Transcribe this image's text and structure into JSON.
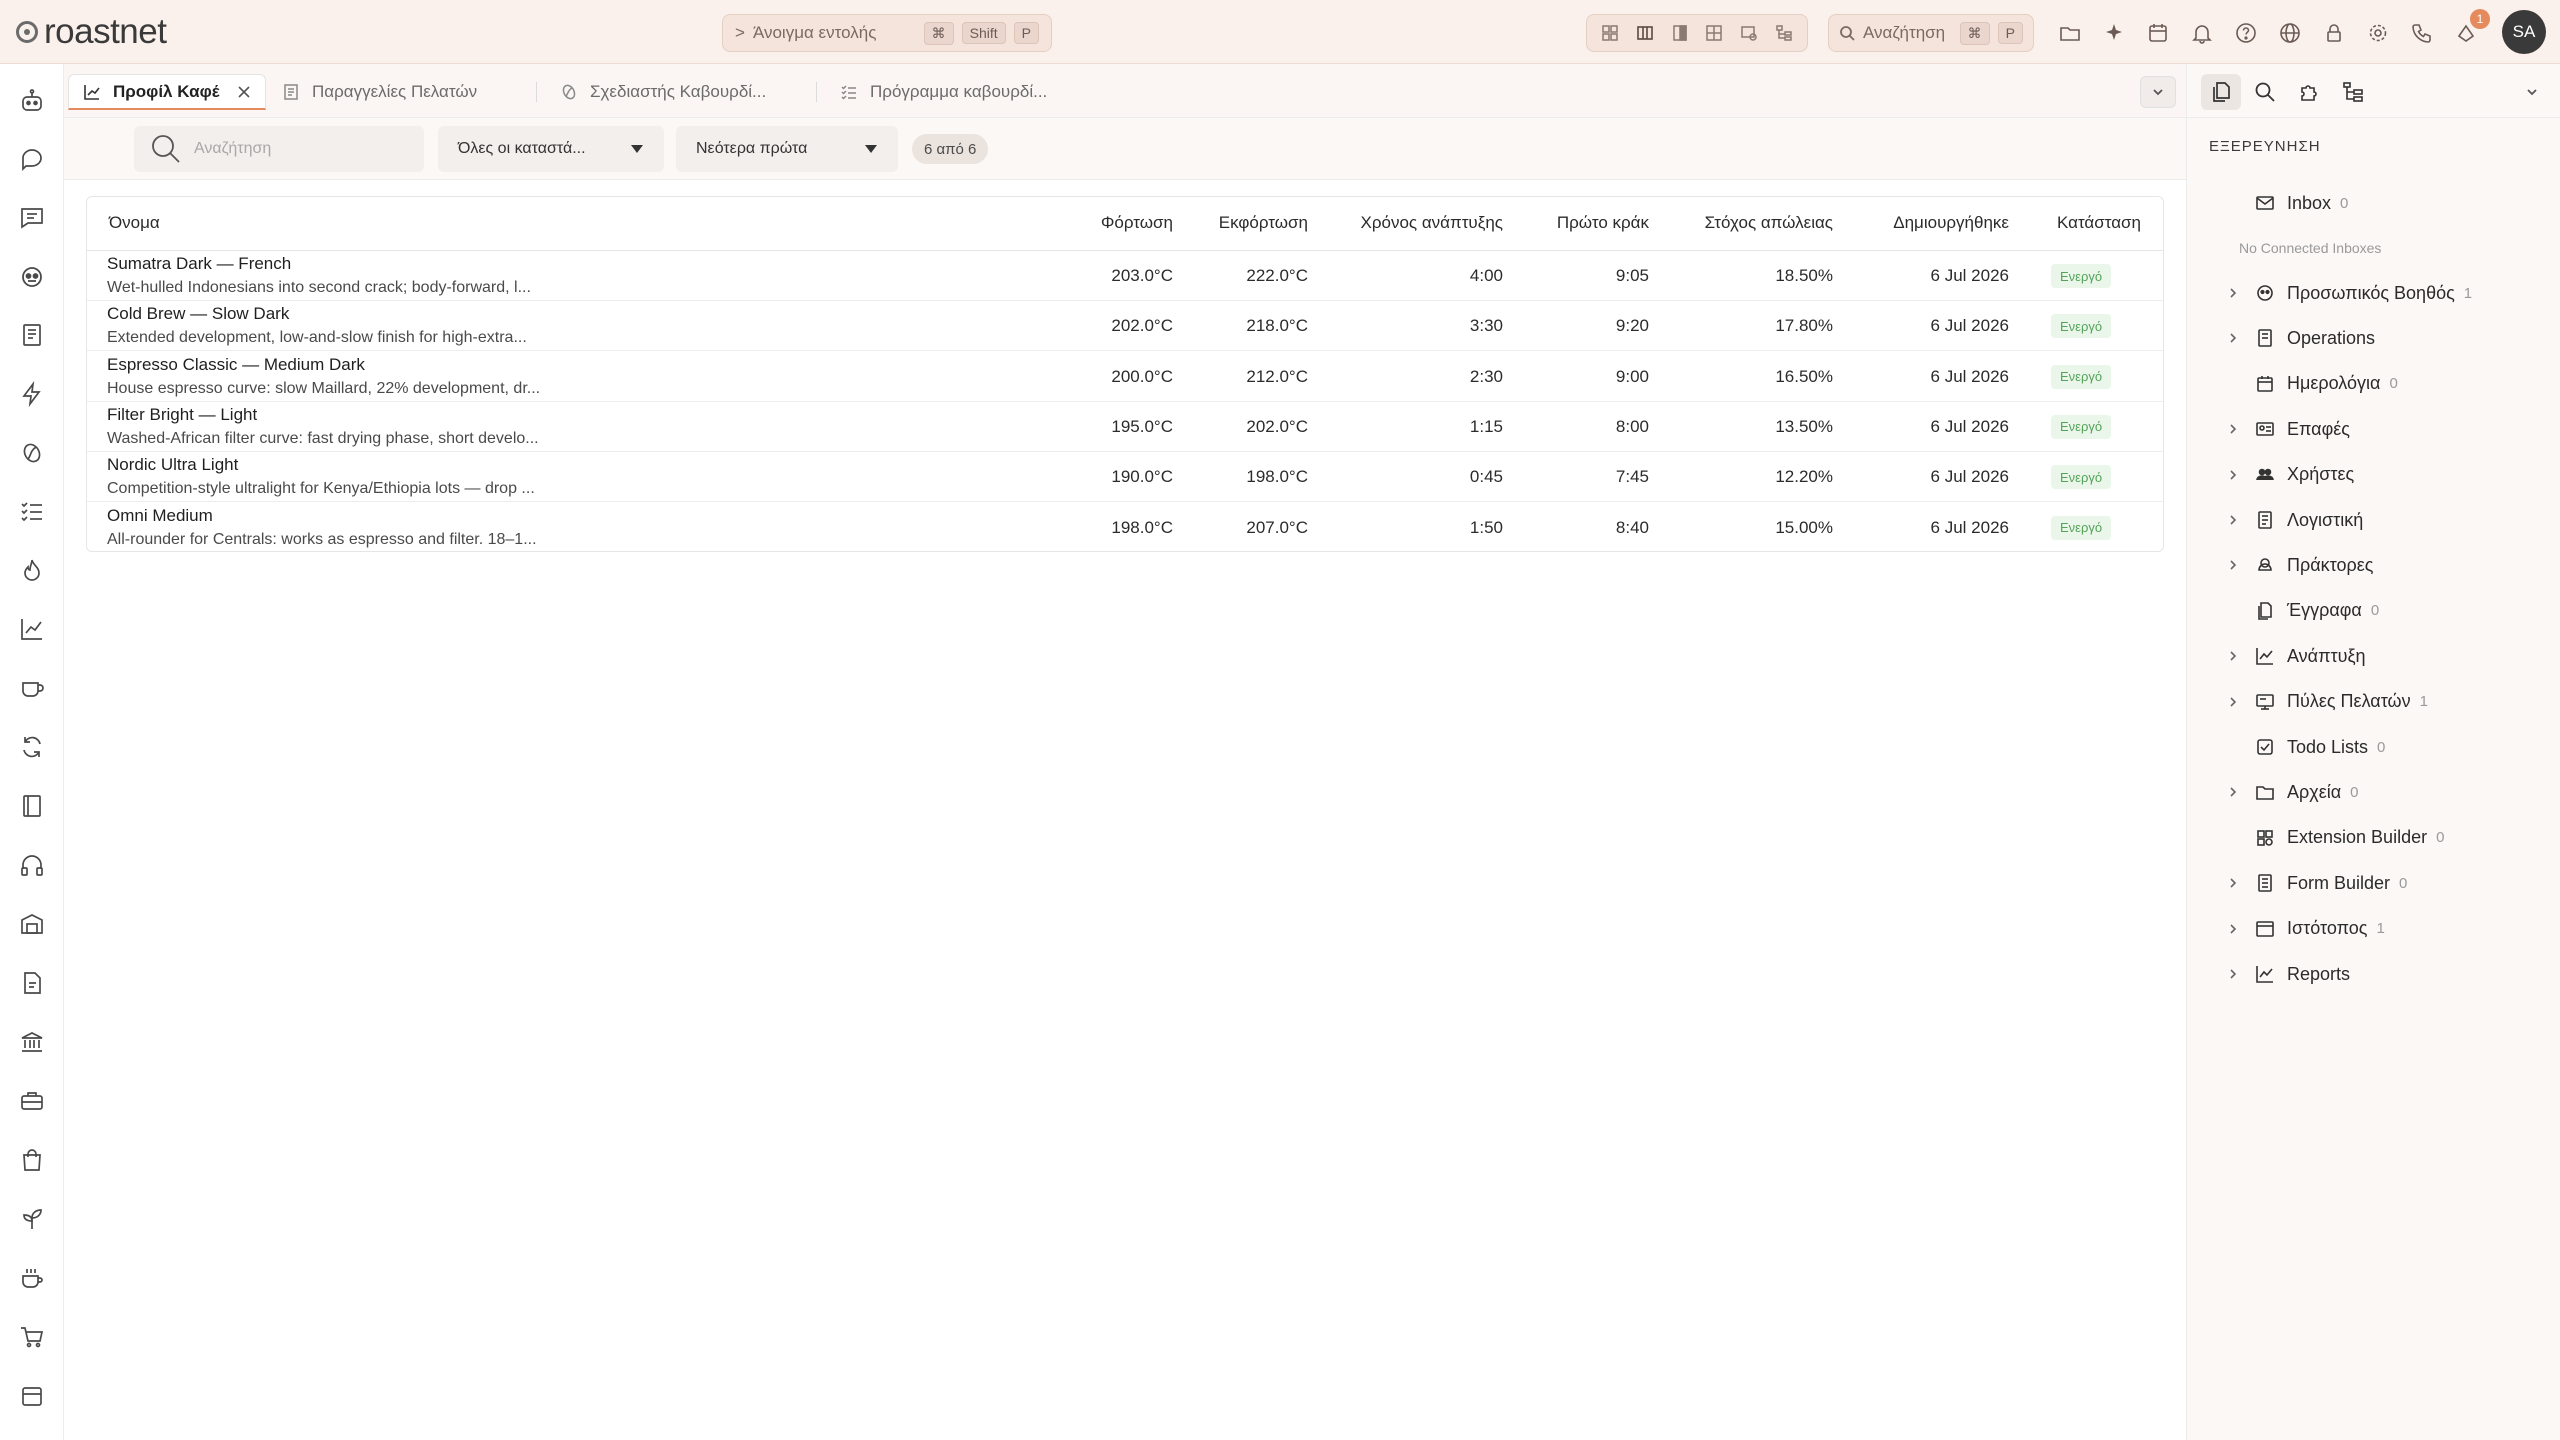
{
  "app": {
    "name": "roastnet"
  },
  "topbar": {
    "command": {
      "prefix": ">",
      "label": "Άνοιγμα εντολής",
      "keys": [
        "⌘",
        "Shift",
        "P"
      ]
    },
    "search": {
      "label": "Αναζήτηση",
      "keys": [
        "⌘",
        "P"
      ]
    },
    "notifications_badge": "1",
    "avatar_initials": "SA"
  },
  "tabs": [
    {
      "label": "Προφίλ Καφέ",
      "icon": "chart-line-icon",
      "active": true
    },
    {
      "label": "Παραγγελίες Πελατών",
      "icon": "document-icon",
      "active": false
    },
    {
      "label": "Σχεδιαστής Καβουρδί...",
      "icon": "bean-icon",
      "active": false
    },
    {
      "label": "Πρόγραμμα καβουρδί...",
      "icon": "list-check-icon",
      "active": false
    }
  ],
  "filters": {
    "search_placeholder": "Αναζήτηση",
    "status_select": "Όλες οι καταστά...",
    "sort_select": "Νεότερα πρώτα",
    "count": "6 από 6"
  },
  "table": {
    "columns": {
      "name": "Όνομα",
      "charge": "Φόρτωση",
      "drop": "Εκφόρτωση",
      "dev_time": "Χρόνος ανάπτυξης",
      "first_crack": "Πρώτο κράκ",
      "loss_target": "Στόχος απώλειας",
      "created": "Δημιουργήθηκε",
      "status": "Κατάσταση"
    },
    "rows": [
      {
        "name": "Sumatra Dark — French",
        "desc": "Wet-hulled Indonesians into second crack; body-forward, l...",
        "charge": "203.0°C",
        "drop": "222.0°C",
        "dev_time": "4:00",
        "first_crack": "9:05",
        "loss_target": "18.50%",
        "created": "6 Jul 2026",
        "status": "Ενεργό"
      },
      {
        "name": "Cold Brew — Slow Dark",
        "desc": "Extended development, low-and-slow finish for high-extra...",
        "charge": "202.0°C",
        "drop": "218.0°C",
        "dev_time": "3:30",
        "first_crack": "9:20",
        "loss_target": "17.80%",
        "created": "6 Jul 2026",
        "status": "Ενεργό"
      },
      {
        "name": "Espresso Classic — Medium Dark",
        "desc": "House espresso curve: slow Maillard, 22% development, dr...",
        "charge": "200.0°C",
        "drop": "212.0°C",
        "dev_time": "2:30",
        "first_crack": "9:00",
        "loss_target": "16.50%",
        "created": "6 Jul 2026",
        "status": "Ενεργό"
      },
      {
        "name": "Filter Bright — Light",
        "desc": "Washed-African filter curve: fast drying phase, short develo...",
        "charge": "195.0°C",
        "drop": "202.0°C",
        "dev_time": "1:15",
        "first_crack": "8:00",
        "loss_target": "13.50%",
        "created": "6 Jul 2026",
        "status": "Ενεργό"
      },
      {
        "name": "Nordic Ultra Light",
        "desc": "Competition-style ultralight for Kenya/Ethiopia lots — drop ...",
        "charge": "190.0°C",
        "drop": "198.0°C",
        "dev_time": "0:45",
        "first_crack": "7:45",
        "loss_target": "12.20%",
        "created": "6 Jul 2026",
        "status": "Ενεργό"
      },
      {
        "name": "Omni Medium",
        "desc": "All-rounder for Centrals: works as espresso and filter. 18–1...",
        "charge": "198.0°C",
        "drop": "207.0°C",
        "dev_time": "1:50",
        "first_crack": "8:40",
        "loss_target": "15.00%",
        "created": "6 Jul 2026",
        "status": "Ενεργό"
      }
    ]
  },
  "explorer": {
    "title": "ΕΞΕΡΕΥΝΗΣΗ",
    "inbox": {
      "label": "Inbox",
      "count": "0"
    },
    "no_inboxes": "No Connected Inboxes",
    "items": [
      {
        "label": "Προσωπικός Βοηθός",
        "count": "1",
        "icon": "robot-icon",
        "expandable": true
      },
      {
        "label": "Operations",
        "count": "",
        "icon": "server-icon",
        "expandable": true
      },
      {
        "label": "Ημερολόγια",
        "count": "0",
        "icon": "calendar-icon",
        "expandable": false
      },
      {
        "label": "Επαφές",
        "count": "",
        "icon": "contact-card-icon",
        "expandable": true
      },
      {
        "label": "Χρήστες",
        "count": "",
        "icon": "users-icon",
        "expandable": true
      },
      {
        "label": "Λογιστική",
        "count": "",
        "icon": "ledger-icon",
        "expandable": true
      },
      {
        "label": "Πράκτορες",
        "count": "",
        "icon": "agent-icon",
        "expandable": true
      },
      {
        "label": "Έγγραφα",
        "count": "0",
        "icon": "documents-icon",
        "expandable": false
      },
      {
        "label": "Ανάπτυξη",
        "count": "",
        "icon": "chart-line-icon",
        "expandable": true
      },
      {
        "label": "Πύλες Πελατών",
        "count": "1",
        "icon": "portal-icon",
        "expandable": true
      },
      {
        "label": "Todo Lists",
        "count": "0",
        "icon": "todo-icon",
        "expandable": false
      },
      {
        "label": "Αρχεία",
        "count": "0",
        "icon": "folder-icon",
        "expandable": true
      },
      {
        "label": "Extension Builder",
        "count": "0",
        "icon": "puzzle-grid-icon",
        "expandable": false
      },
      {
        "label": "Form Builder",
        "count": "0",
        "icon": "form-icon",
        "expandable": true
      },
      {
        "label": "Ιστότοπος",
        "count": "1",
        "icon": "browser-icon",
        "expandable": true
      },
      {
        "label": "Reports",
        "count": "",
        "icon": "chart-line-icon",
        "expandable": true
      }
    ]
  },
  "colors": {
    "accent": "#e58a5c",
    "topbar_bg": "#fbf1ec",
    "status_green": "#55a35b"
  }
}
